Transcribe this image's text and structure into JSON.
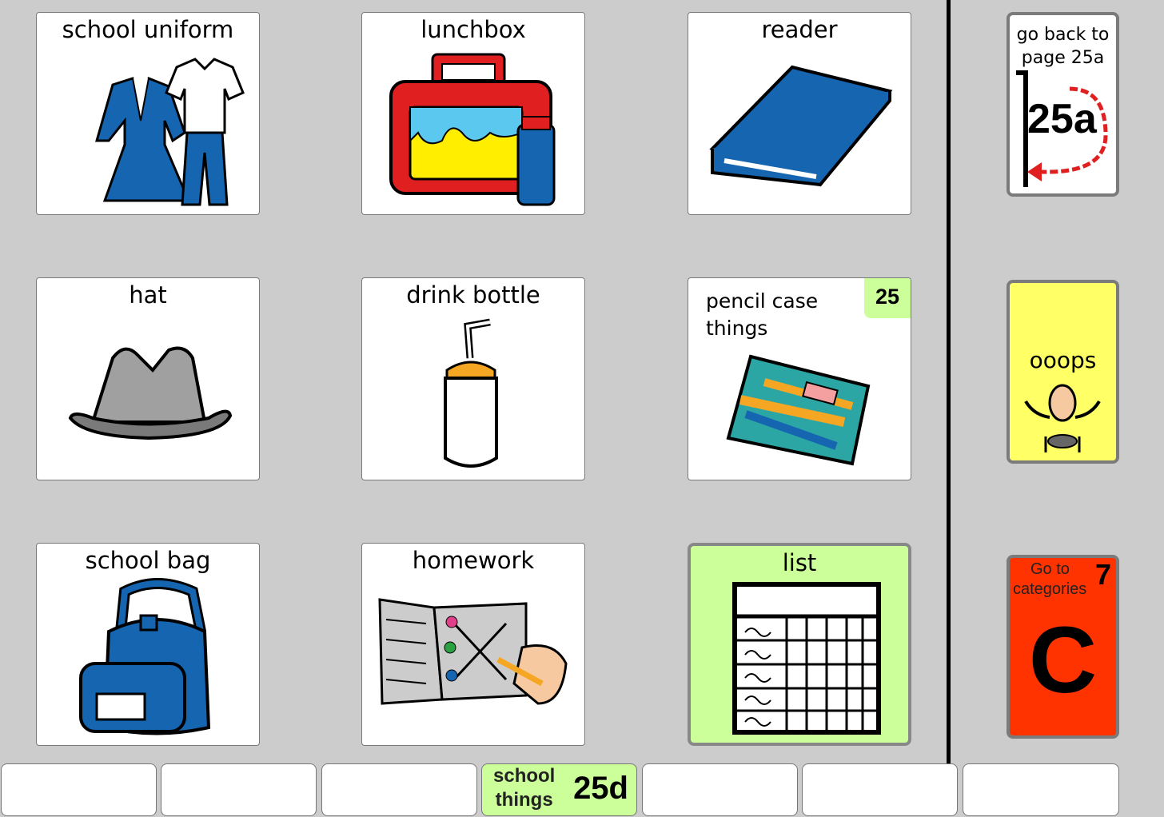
{
  "grid": [
    {
      "label": "school uniform",
      "icon": "school-uniform-icon"
    },
    {
      "label": "lunchbox",
      "icon": "lunchbox-icon"
    },
    {
      "label": "reader",
      "icon": "reader-book-icon"
    },
    {
      "label": "hat",
      "icon": "hat-icon"
    },
    {
      "label": "drink bottle",
      "icon": "drink-bottle-icon"
    },
    {
      "label": "pencil case things",
      "label_line1": "pencil case",
      "label_line2": "things",
      "badge": "25",
      "icon": "pencil-case-icon"
    },
    {
      "label": "school bag",
      "icon": "school-bag-icon"
    },
    {
      "label": "homework",
      "icon": "homework-icon"
    },
    {
      "label": "list",
      "icon": "list-grid-icon"
    }
  ],
  "side": {
    "back": {
      "line1": "go back to",
      "line2": "page 25a",
      "page": "25a",
      "icon": "back-arrow-icon"
    },
    "oops": {
      "label": "ooops",
      "icon": "falling-person-icon"
    },
    "categories": {
      "line1": "Go to",
      "line2": "categories",
      "badge": "7",
      "letter": "C"
    }
  },
  "tabs": {
    "active": {
      "line1": "school",
      "line2": "things",
      "page": "25d"
    }
  },
  "colors": {
    "background": "#cccccc",
    "card": "#ffffff",
    "link_green": "#ccff99",
    "oops_yellow": "#ffff66",
    "categories_red": "#ff3300",
    "uniform_blue": "#1565b0"
  }
}
